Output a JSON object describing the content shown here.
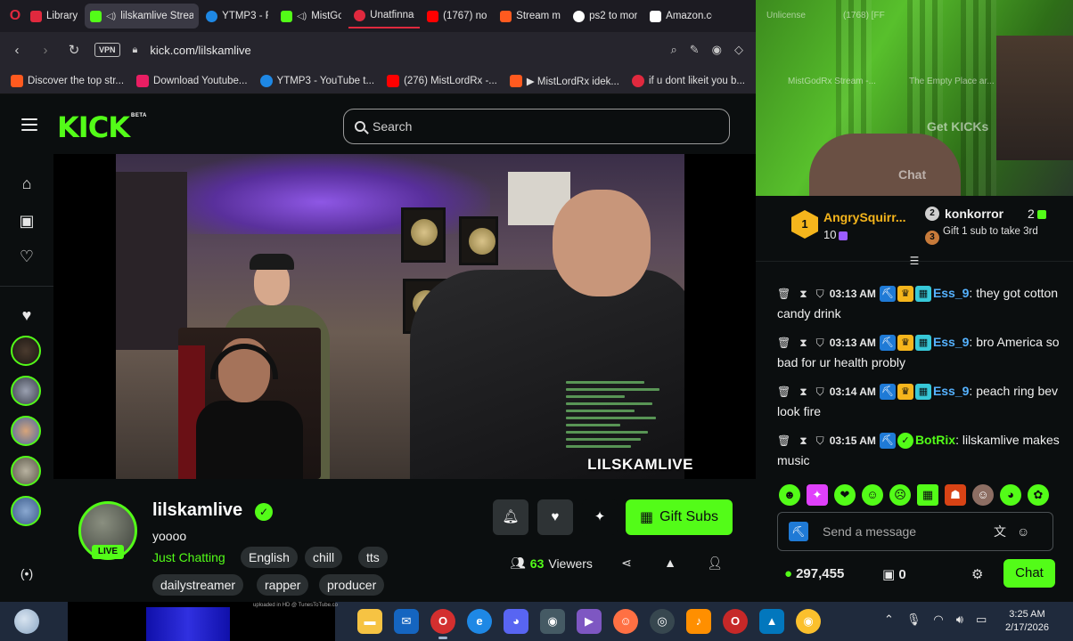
{
  "browser": {
    "tabs": [
      {
        "label": "Library",
        "color": "#e0293e",
        "active": false
      },
      {
        "label": "lilskamlive Strea",
        "color": "#53fc18",
        "active": true
      },
      {
        "label": "YTMP3 - Fr",
        "color": "#1e88e5",
        "active": false
      },
      {
        "label": "MistGo",
        "color": "#53fc18",
        "active": false
      },
      {
        "label": "Unatfinnag",
        "color": "#e0293e",
        "active": false
      },
      {
        "label": "(1767) no i",
        "color": "#ff0000",
        "active": false
      },
      {
        "label": "Stream mis",
        "color": "#ff5a1f",
        "active": false
      },
      {
        "label": "ps2 to mor",
        "color": "#ffffff",
        "active": false
      },
      {
        "label": "Amazon.co",
        "color": "#ffffff",
        "active": false
      }
    ],
    "url": "kick.com/lilskamlive",
    "vpn_label": "VPN",
    "bookmarks": [
      {
        "label": "Discover the top str...",
        "color": "#ff5a1f"
      },
      {
        "label": "Download Youtube...",
        "color": "#e91e63"
      },
      {
        "label": "YTMP3 - YouTube t...",
        "color": "#1e88e5"
      },
      {
        "label": "(276) MistLordRx -...",
        "color": "#ff0000"
      },
      {
        "label": "▶ MistLordRx idek...",
        "color": "#ff5a1f"
      },
      {
        "label": "if u dont likeit you b...",
        "color": "#e0293e"
      }
    ]
  },
  "kick": {
    "logo": "KICK",
    "beta": "BETA",
    "search_placeholder": "Search"
  },
  "video": {
    "watermark": "LILSKAMLIVE"
  },
  "stream": {
    "streamer": "lilskamlive",
    "live_label": "LIVE",
    "title": "yoooo",
    "category": "Just Chatting",
    "tags": [
      "English",
      "chill",
      "tts",
      "dailystreamer",
      "rapper",
      "producer"
    ],
    "gift_label": "Gift Subs",
    "viewer_count": "63",
    "viewers_label": "Viewers"
  },
  "webcam_overlay": {
    "top_text": "Unlicense",
    "notice": "(1768) [FF",
    "nav_1": "MistGodRx Stream -...",
    "nav_2": "The Empty Place ar...",
    "get_kicks": "Get KICKs",
    "chat": "Chat"
  },
  "leaderboard": {
    "first": {
      "rank": "1",
      "name": "AngrySquirr...",
      "count": "10"
    },
    "second": {
      "rank": "2",
      "name": "konkorror",
      "count": "2"
    },
    "third": {
      "rank": "3",
      "hint": "Gift 1 sub to take 3rd"
    }
  },
  "chat": {
    "messages": [
      {
        "time": "03:13 AM",
        "user": "Ess_9",
        "text": "they got cotton candy drink"
      },
      {
        "time": "03:13 AM",
        "user": "Ess_9",
        "text": "bro America so bad for ur health probly"
      },
      {
        "time": "03:14 AM",
        "user": "Ess_9",
        "text": "peach ring bev look fire"
      },
      {
        "time": "03:15 AM",
        "user": "BotRix",
        "text": "lilskamlive makes music"
      }
    ],
    "input_placeholder": "Send a message",
    "points": "297,455",
    "gifts": "0",
    "send_label": "Chat"
  },
  "taskbar": {
    "time": "3:25 AM",
    "date": "2/17/2026",
    "tiny_caption": "uploaded in HD @ TunesToTube.co"
  }
}
